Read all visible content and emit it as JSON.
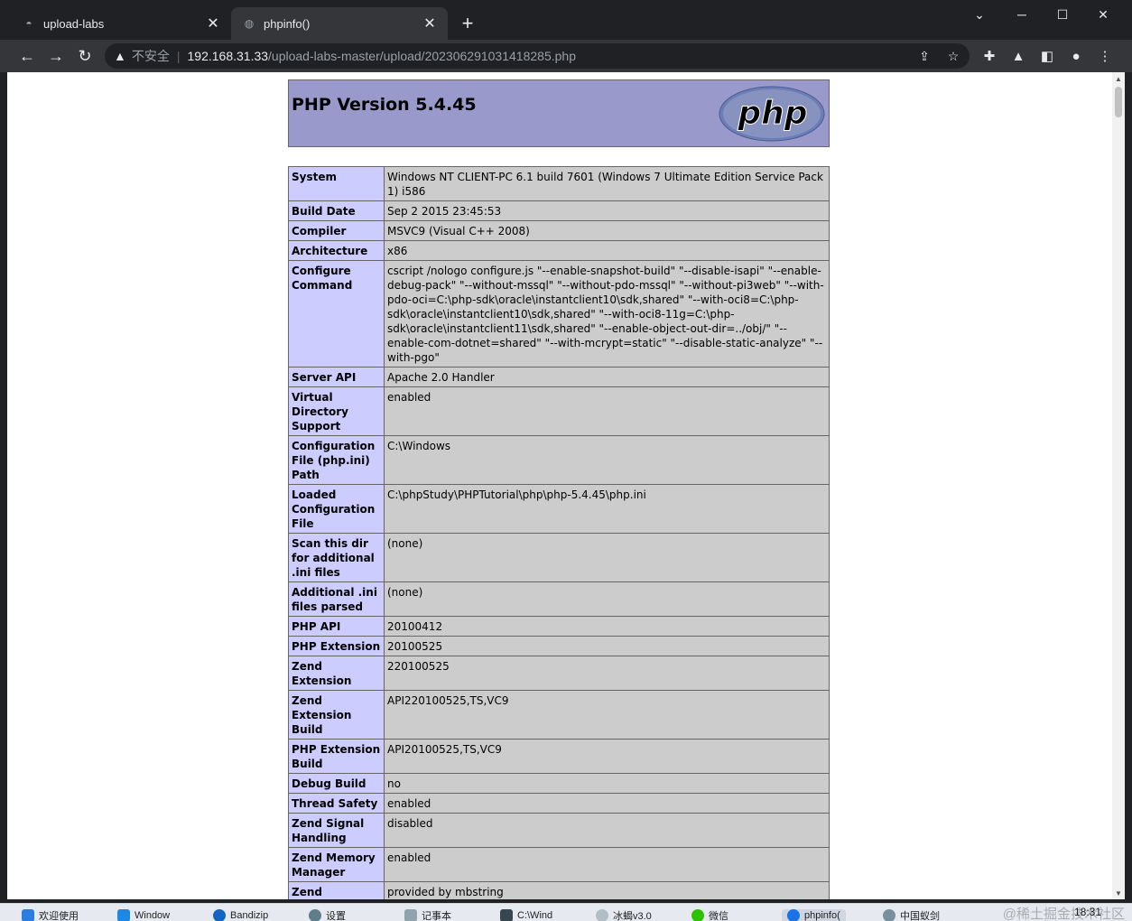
{
  "browser": {
    "tabs": [
      {
        "title": "upload-labs",
        "active": false,
        "icon": "site-icon"
      },
      {
        "title": "phpinfo()",
        "active": true,
        "icon": "globe-icon"
      }
    ],
    "omnibox": {
      "security_label": "不安全",
      "host": "192.168.31.33",
      "path": "/upload-labs-master/upload/202306291031418285.php"
    }
  },
  "phpinfo": {
    "version_title": "PHP Version 5.4.45",
    "logo_text": "php",
    "rows": [
      {
        "key": "System",
        "value": "Windows NT CLIENT-PC 6.1 build 7601 (Windows 7 Ultimate Edition Service Pack 1) i586"
      },
      {
        "key": "Build Date",
        "value": "Sep 2 2015 23:45:53"
      },
      {
        "key": "Compiler",
        "value": "MSVC9 (Visual C++ 2008)"
      },
      {
        "key": "Architecture",
        "value": "x86"
      },
      {
        "key": "Configure Command",
        "value": "cscript /nologo configure.js \"--enable-snapshot-build\" \"--disable-isapi\" \"--enable-debug-pack\" \"--without-mssql\" \"--without-pdo-mssql\" \"--without-pi3web\" \"--with-pdo-oci=C:\\php-sdk\\oracle\\instantclient10\\sdk,shared\" \"--with-oci8=C:\\php-sdk\\oracle\\instantclient10\\sdk,shared\" \"--with-oci8-11g=C:\\php-sdk\\oracle\\instantclient11\\sdk,shared\" \"--enable-object-out-dir=../obj/\" \"--enable-com-dotnet=shared\" \"--with-mcrypt=static\" \"--disable-static-analyze\" \"--with-pgo\""
      },
      {
        "key": "Server API",
        "value": "Apache 2.0 Handler"
      },
      {
        "key": "Virtual Directory Support",
        "value": "enabled"
      },
      {
        "key": "Configuration File (php.ini) Path",
        "value": "C:\\Windows"
      },
      {
        "key": "Loaded Configuration File",
        "value": "C:\\phpStudy\\PHPTutorial\\php\\php-5.4.45\\php.ini"
      },
      {
        "key": "Scan this dir for additional .ini files",
        "value": "(none)"
      },
      {
        "key": "Additional .ini files parsed",
        "value": "(none)"
      },
      {
        "key": "PHP API",
        "value": "20100412"
      },
      {
        "key": "PHP Extension",
        "value": "20100525"
      },
      {
        "key": "Zend Extension",
        "value": "220100525"
      },
      {
        "key": "Zend Extension Build",
        "value": "API220100525,TS,VC9"
      },
      {
        "key": "PHP Extension Build",
        "value": "API20100525,TS,VC9"
      },
      {
        "key": "Debug Build",
        "value": "no"
      },
      {
        "key": "Thread Safety",
        "value": "enabled"
      },
      {
        "key": "Zend Signal Handling",
        "value": "disabled"
      },
      {
        "key": "Zend Memory Manager",
        "value": "enabled"
      },
      {
        "key": "Zend Multibyte Support",
        "value": "provided by mbstring"
      },
      {
        "key": "",
        "value": ""
      }
    ]
  },
  "taskbar": {
    "items": [
      "欢迎使用",
      "Window",
      "Bandizip",
      "设置",
      "记事本",
      "C:\\Wind",
      "冰蝎v3.0",
      "微信",
      "phpinfo(",
      "中国蚁剑"
    ],
    "clock": "18:31",
    "watermark": "@稀土掘金技术社区"
  },
  "colors": {
    "header_bg": "#9999cc",
    "key_bg": "#ccccff",
    "value_bg": "#cccccc"
  }
}
